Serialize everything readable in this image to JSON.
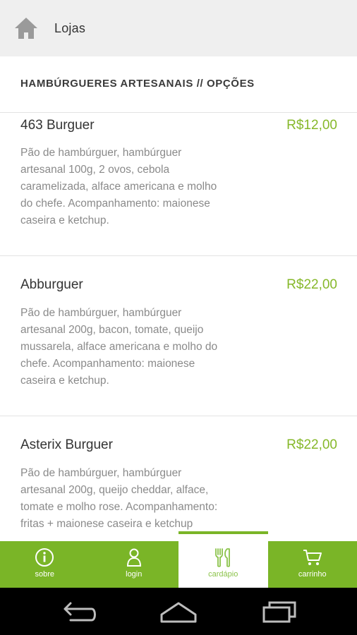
{
  "header": {
    "title": "Lojas",
    "home_icon": "home-icon"
  },
  "section": {
    "title": "HAMBÚRGUERES ARTESANAIS // OPÇÕES"
  },
  "items": [
    {
      "name": "463 Burguer",
      "price": "R$12,00",
      "desc_lines": [
        "Pão de hambúrguer, hambúrguer",
        "artesanal 100g, 2 ovos, cebola",
        "caramelizada, alface americana e molho",
        "do chefe. Acompanhamento: maionese",
        "caseira e ketchup."
      ]
    },
    {
      "name": "Abburguer",
      "price": "R$22,00",
      "desc_lines": [
        "Pão de hambúrguer, hambúrguer",
        "artesanal 200g, bacon, tomate, queijo",
        "mussarela, alface americana e molho do",
        "chefe. Acompanhamento: maionese",
        "caseira e ketchup."
      ]
    },
    {
      "name": "Asterix Burguer",
      "price": "R$22,00",
      "desc_lines": [
        "Pão de hambúrguer, hambúrguer",
        "artesanal 200g, queijo cheddar, alface,",
        "tomate e molho rose. Acompanhamento:",
        "fritas + maionese caseira e ketchup"
      ]
    }
  ],
  "nav": {
    "tabs": [
      {
        "label": "sobre",
        "icon": "info-icon",
        "active": false
      },
      {
        "label": "login",
        "icon": "user-icon",
        "active": false
      },
      {
        "label": "cardápio",
        "icon": "cutlery-icon",
        "active": true
      },
      {
        "label": "carrinho",
        "icon": "cart-icon",
        "active": false
      }
    ]
  },
  "system_bar": {
    "buttons": [
      "back-icon",
      "home-icon",
      "recent-apps-icon"
    ]
  },
  "colors": {
    "accent": "#7ab527",
    "price": "#86b82a",
    "header_bg": "#efefef"
  }
}
